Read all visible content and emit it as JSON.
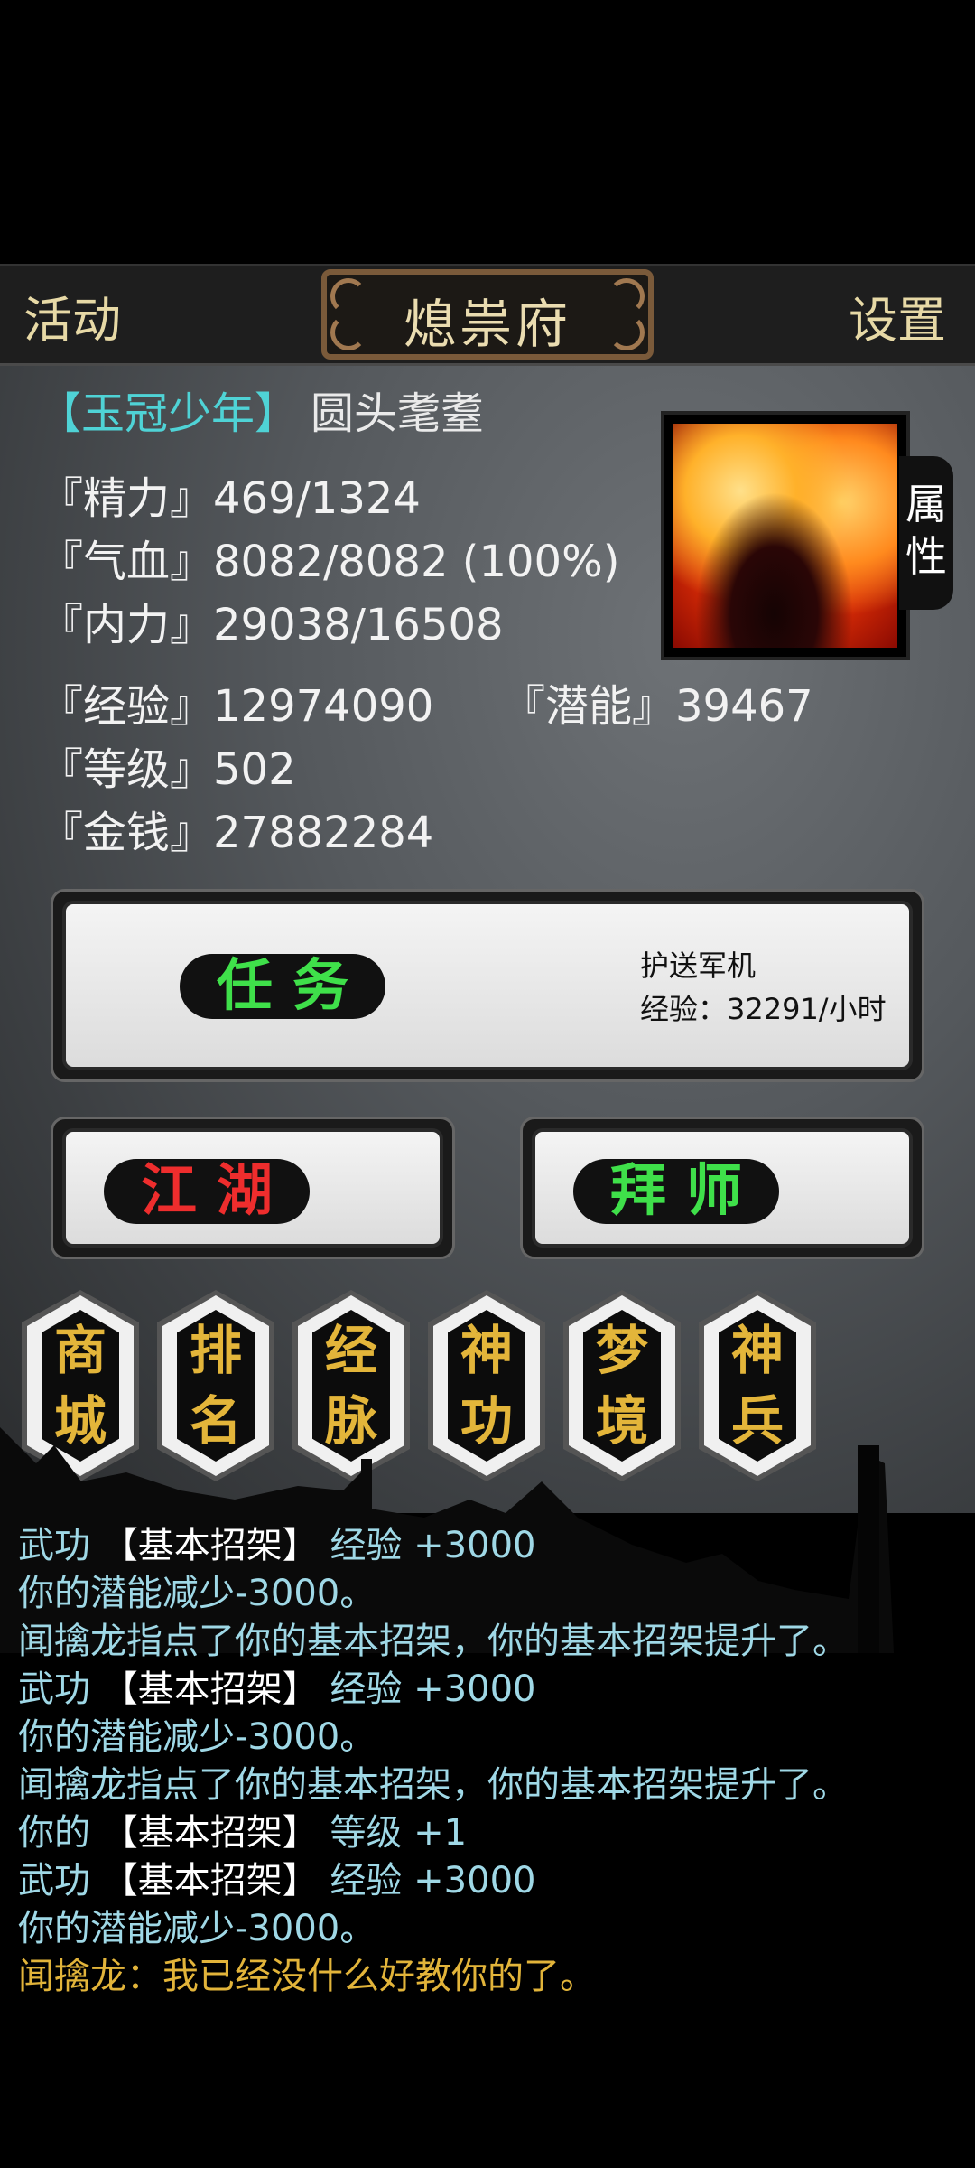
{
  "topbar": {
    "left_label": "活动",
    "title": "熄祟府",
    "right_label": "设置"
  },
  "character": {
    "title": "【玉冠少年】",
    "name": "圆头耄耋",
    "attr_tab": [
      "属",
      "性"
    ]
  },
  "stats": {
    "energy": "『精力』469/1324",
    "hp": "『气血』8082/8082 (100%)",
    "internal": "『内力』29038/16508",
    "exp": "『经验』12974090",
    "potential": "『潜能』39467",
    "level": "『等级』502",
    "money": "『金钱』27882284"
  },
  "task_card": {
    "button_label": "任务",
    "task_name": "护送军机",
    "task_exp": "经验：32291/小时"
  },
  "buttons": {
    "jianghu": "江湖",
    "baishi": "拜师"
  },
  "menu": [
    {
      "label": "商城",
      "l1": "商",
      "l2": "城"
    },
    {
      "label": "排名",
      "l1": "排",
      "l2": "名"
    },
    {
      "label": "经脉",
      "l1": "经",
      "l2": "脉"
    },
    {
      "label": "神功",
      "l1": "神",
      "l2": "功"
    },
    {
      "label": "梦境",
      "l1": "梦",
      "l2": "境"
    },
    {
      "label": "神兵",
      "l1": "神",
      "l2": "兵"
    }
  ],
  "log": [
    {
      "pre": "武功",
      "hl": "【基本招架】",
      "post": "经验 +3000",
      "kind": "skill"
    },
    {
      "text": "你的潜能减少-3000。",
      "kind": "plain"
    },
    {
      "text": "闻擒龙指点了你的基本招架，你的基本招架提升了。",
      "kind": "plain"
    },
    {
      "pre": "武功",
      "hl": "【基本招架】",
      "post": "经验 +3000",
      "kind": "skill"
    },
    {
      "text": "你的潜能减少-3000。",
      "kind": "plain"
    },
    {
      "text": "闻擒龙指点了你的基本招架，你的基本招架提升了。",
      "kind": "plain"
    },
    {
      "pre": "你的",
      "hl": "【基本招架】",
      "post": "等级 +1",
      "kind": "skill"
    },
    {
      "pre": "武功",
      "hl": "【基本招架】",
      "post": "经验 +3000",
      "kind": "skill"
    },
    {
      "text": "你的潜能减少-3000。",
      "kind": "plain"
    },
    {
      "text": "闻擒龙：我已经没什么好教你的了。",
      "kind": "npc"
    }
  ],
  "colors": {
    "log_plain": "#9fd8e6",
    "log_highlight": "#ffffff",
    "log_npc": "#e2b43a",
    "menu_gold": "#e3b53a",
    "title_cyan": "#4fd3d6"
  }
}
